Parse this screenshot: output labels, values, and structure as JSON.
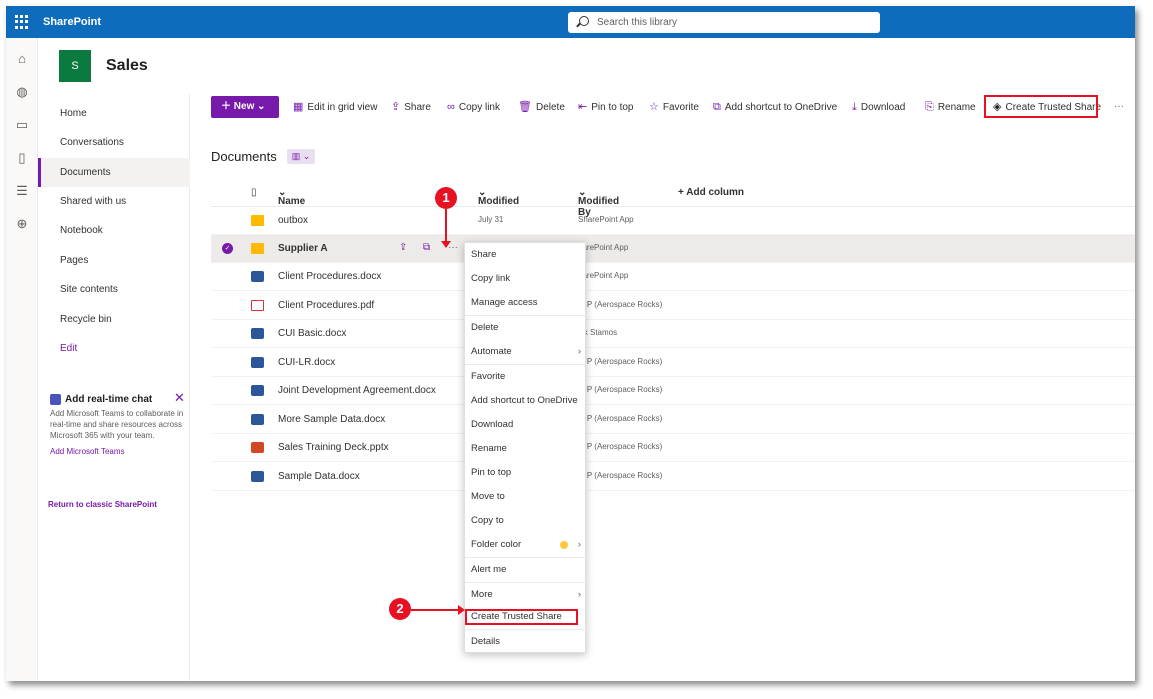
{
  "app": {
    "name": "SharePoint"
  },
  "search": {
    "placeholder": "Search this library"
  },
  "site": {
    "logo_letter": "S",
    "title": "Sales"
  },
  "nav": {
    "items": [
      {
        "label": "Home"
      },
      {
        "label": "Conversations"
      },
      {
        "label": "Documents"
      },
      {
        "label": "Shared with us"
      },
      {
        "label": "Notebook"
      },
      {
        "label": "Pages"
      },
      {
        "label": "Site contents"
      },
      {
        "label": "Recycle bin"
      }
    ],
    "edit_label": "Edit",
    "active": "Documents"
  },
  "chat_promo": {
    "title": "Add real-time chat",
    "description": "Add Microsoft Teams to collaborate in real-time and share resources across Microsoft 365 with your team.",
    "link": "Add Microsoft Teams"
  },
  "classic_link": "Return to classic SharePoint",
  "commands": {
    "new": "New",
    "edit_grid": "Edit in grid view",
    "share": "Share",
    "copy_link": "Copy link",
    "delete": "Delete",
    "pin": "Pin to top",
    "favorite": "Favorite",
    "add_shortcut": "Add shortcut to OneDrive",
    "download": "Download",
    "rename": "Rename",
    "trusted_share": "Create Trusted Share",
    "more": "···"
  },
  "library": {
    "title": "Documents",
    "columns": {
      "name": "Name",
      "modified": "Modified",
      "modified_by": "Modified By",
      "add_column": "+ Add column"
    },
    "rows": [
      {
        "name": "outbox",
        "type": "folder",
        "modified": "July 31",
        "modified_by": "SharePoint App"
      },
      {
        "name": "Supplier A",
        "type": "folder",
        "modified": "",
        "modified_by": "harePoint App",
        "selected": true
      },
      {
        "name": "Client Procedures.docx",
        "type": "word",
        "modified": "",
        "modified_by": "harePoint App"
      },
      {
        "name": "Client Procedures.pdf",
        "type": "pdf",
        "modified": "",
        "modified_by": "m P (Aerospace Rocks)"
      },
      {
        "name": "CUI Basic.docx",
        "type": "word",
        "modified": "",
        "modified_by": "ick Stamos"
      },
      {
        "name": "CUI-LR.docx",
        "type": "word",
        "modified": "",
        "modified_by": "m P (Aerospace Rocks)"
      },
      {
        "name": "Joint Development Agreement.docx",
        "type": "word",
        "modified": "",
        "modified_by": "m P (Aerospace Rocks)"
      },
      {
        "name": "More Sample Data.docx",
        "type": "word",
        "modified": "",
        "modified_by": "m P (Aerospace Rocks)"
      },
      {
        "name": "Sales Training Deck.pptx",
        "type": "ppt",
        "modified": "",
        "modified_by": "m P (Aerospace Rocks)"
      },
      {
        "name": "Sample Data.docx",
        "type": "word",
        "modified": "",
        "modified_by": "m P (Aerospace Rocks)"
      }
    ]
  },
  "context_menu": {
    "items": [
      {
        "label": "Share"
      },
      {
        "label": "Copy link"
      },
      {
        "label": "Manage access"
      },
      {
        "label": "Delete"
      },
      {
        "label": "Automate",
        "submenu": true
      },
      {
        "label": "Favorite"
      },
      {
        "label": "Add shortcut to OneDrive"
      },
      {
        "label": "Download"
      },
      {
        "label": "Rename"
      },
      {
        "label": "Pin to top"
      },
      {
        "label": "Move to"
      },
      {
        "label": "Copy to"
      },
      {
        "label": "Folder color",
        "submenu": true
      },
      {
        "label": "Alert me"
      },
      {
        "label": "More",
        "submenu": true
      },
      {
        "label": "Create Trusted Share"
      },
      {
        "label": "Details"
      }
    ]
  },
  "callouts": {
    "step1": "1",
    "step2": "2"
  },
  "colors": {
    "suite_bar": "#0f6cbd",
    "accent": "#7719aa",
    "highlight": "#e81123",
    "site_logo": "#0b7a3e"
  }
}
